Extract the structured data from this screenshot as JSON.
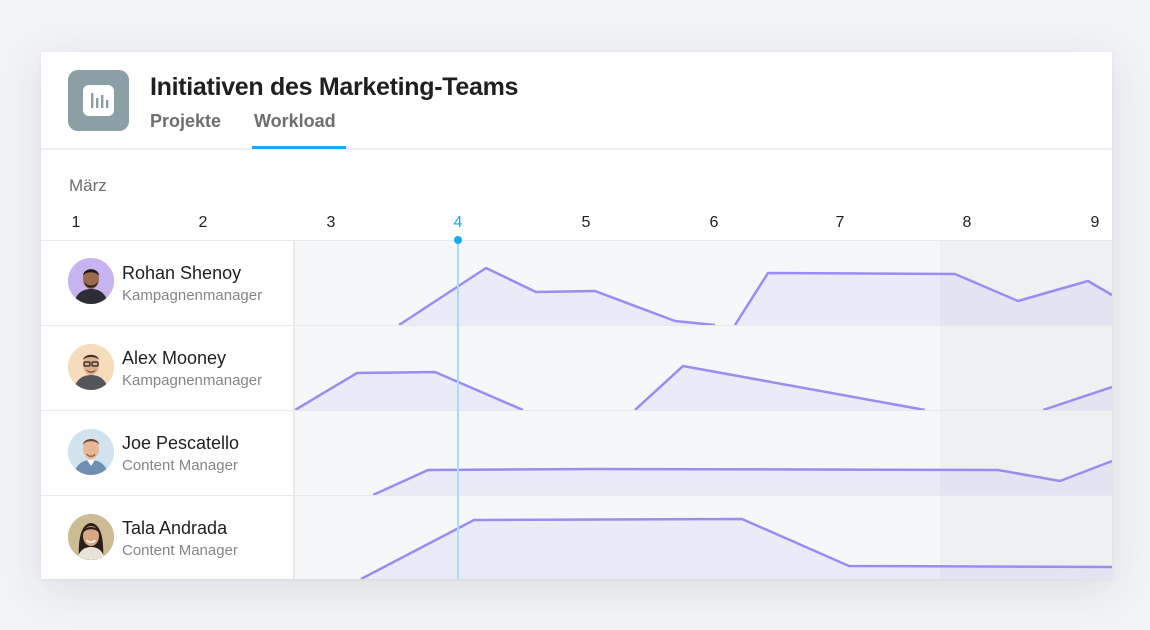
{
  "project": {
    "icon": "bar-chart-icon",
    "icon_color": "#8aa0a5",
    "title": "Initiativen des Marketing-Teams"
  },
  "tabs": [
    {
      "label": "Projekte",
      "active": false
    },
    {
      "label": "Workload",
      "active": true
    }
  ],
  "accent_color": "#14aaf5",
  "workload_color": "#9b8cf2",
  "timeline": {
    "month": "März",
    "days": [
      "1",
      "2",
      "3",
      "4",
      "5",
      "6",
      "7",
      "8",
      "9"
    ],
    "today": "4"
  },
  "people": [
    {
      "name": "Rohan Shenoy",
      "role": "Kampagnenmanager"
    },
    {
      "name": "Alex Mooney",
      "role": "Kampagnenmanager"
    },
    {
      "name": "Joe Pescatello",
      "role": "Content Manager"
    },
    {
      "name": "Tala Andrada",
      "role": "Content Manager"
    }
  ]
}
